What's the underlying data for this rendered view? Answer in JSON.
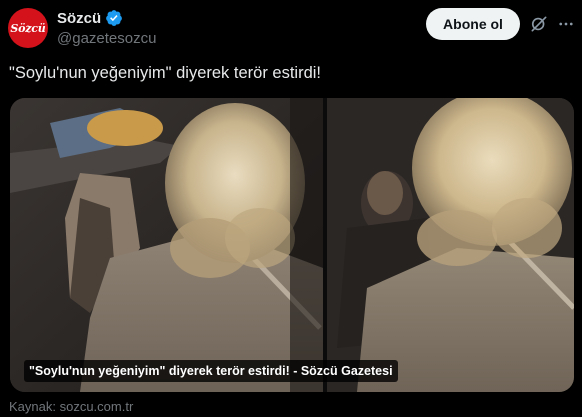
{
  "account": {
    "display_name": "Sözcü",
    "handle": "@gazetesozcu",
    "avatar_text": "Sözcü",
    "verified": true
  },
  "actions": {
    "follow_label": "Abone ol",
    "grok_icon": "grok-icon",
    "more_icon": "more-icon"
  },
  "tweet": {
    "text": "\"Soylu'nun yeğeniyim\" diyerek terör estirdi!"
  },
  "card": {
    "caption": "\"Soylu'nun yeğeniyim\" diyerek terör estirdi! - Sözcü Gazetesi",
    "source": "Kaynak: sozcu.com.tr"
  },
  "colors": {
    "brand_red": "#d3121b",
    "verified_blue": "#1d9bf0",
    "background": "#000000",
    "text_primary": "#e7e9ea",
    "text_secondary": "#71767b"
  }
}
